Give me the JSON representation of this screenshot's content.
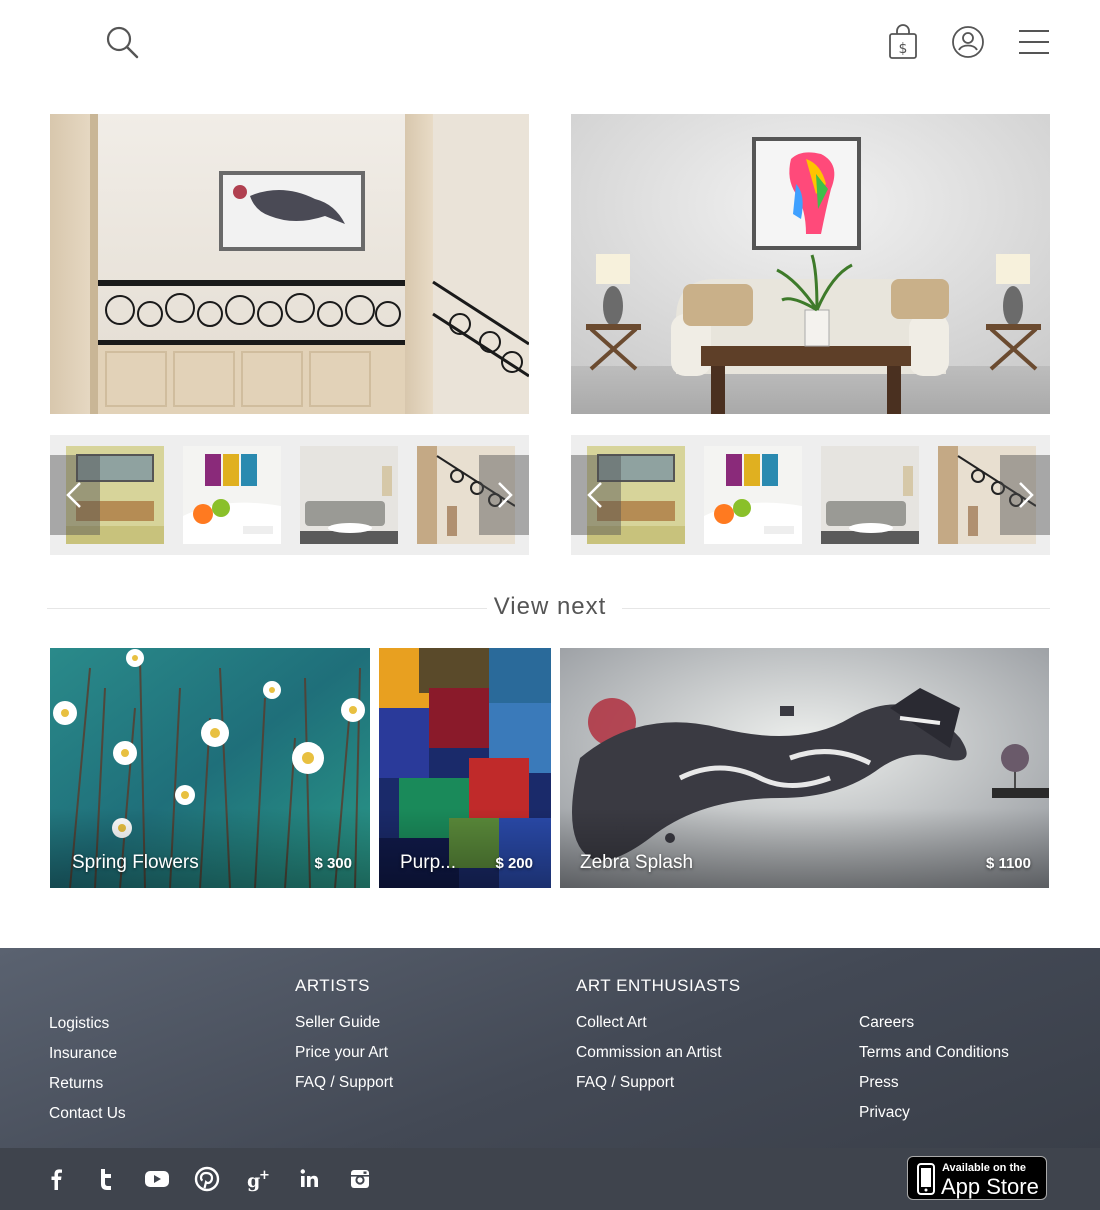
{
  "header": {
    "icons": [
      "search-icon",
      "shopping-bag-dollar-icon",
      "user-icon",
      "hamburger-menu-icon"
    ]
  },
  "view_next": {
    "title": "View next",
    "cards": [
      {
        "title": "Spring Flowers",
        "price": "$ 300"
      },
      {
        "title": "Purp...",
        "price": "$ 200"
      },
      {
        "title": "Zebra Splash",
        "price": "$ 1100"
      }
    ]
  },
  "footer": {
    "col1": {
      "links": [
        "Logistics",
        "Insurance",
        "Returns",
        "Contact Us"
      ]
    },
    "artists": {
      "heading": "ARTISTS",
      "links": [
        "Seller Guide",
        "Price your Art",
        "FAQ / Support"
      ]
    },
    "enthusiasts": {
      "heading": "ART ENTHUSIASTS",
      "links": [
        "Collect Art",
        "Commission an Artist",
        "FAQ / Support"
      ]
    },
    "col4": {
      "links": [
        "Careers",
        "Terms and Conditions",
        "Press",
        "Privacy"
      ]
    }
  },
  "social": {
    "icons": [
      "facebook-icon",
      "twitter-icon",
      "youtube-icon",
      "pinterest-icon",
      "google-plus-icon",
      "linkedin-icon",
      "instagram-icon"
    ],
    "appstore_small": "Available on the",
    "appstore_big": "App Store"
  }
}
